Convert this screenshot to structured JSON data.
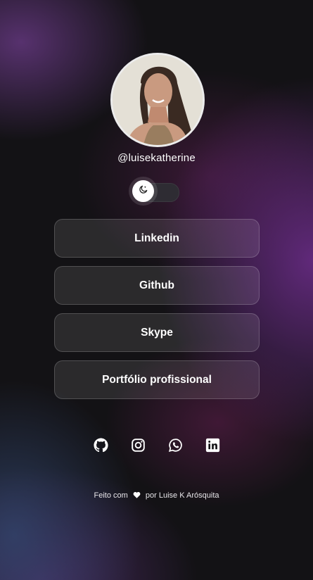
{
  "profile": {
    "username": "@luisekatherine"
  },
  "theme_toggle": {
    "icon": "moon-icon",
    "state": "dark"
  },
  "links": [
    {
      "label": "Linkedin"
    },
    {
      "label": "Github"
    },
    {
      "label": "Skype"
    },
    {
      "label": "Portfólio profissional"
    }
  ],
  "social": [
    "github-icon",
    "instagram-icon",
    "whatsapp-icon",
    "linkedin-icon"
  ],
  "footer": {
    "prefix": "Feito com",
    "icon": "heart-icon",
    "suffix": "por Luise K Arósquita"
  },
  "colors": {
    "background": "#131215",
    "accent_purple": "#6e2d8c",
    "button_bg": "rgba(255,255,255,0.10)"
  }
}
